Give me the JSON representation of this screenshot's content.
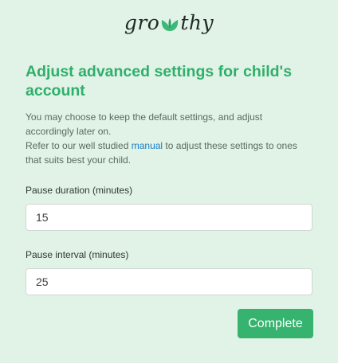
{
  "brand": {
    "logo_left": "gro",
    "logo_right": "thy",
    "leaf_icon": "leaf-icon",
    "leaf_color": "#3cb878"
  },
  "header": {
    "title": "Adjust advanced settings for child's account"
  },
  "description": {
    "line1": "You may choose to keep the default settings, and adjust accordingly later on.",
    "line2_before": "Refer to our well studied ",
    "manual_link": "manual",
    "line2_after": " to adjust these settings to ones that suits best your child."
  },
  "form": {
    "pause_duration_label": "Pause duration (minutes)",
    "pause_duration_value": "15",
    "pause_interval_label": "Pause interval (minutes)",
    "pause_interval_value": "25"
  },
  "actions": {
    "complete_label": "Complete"
  },
  "colors": {
    "background": "#e1f2e7",
    "accent": "#2fb06a",
    "button": "#36b36f",
    "link": "#1a7fc4"
  }
}
